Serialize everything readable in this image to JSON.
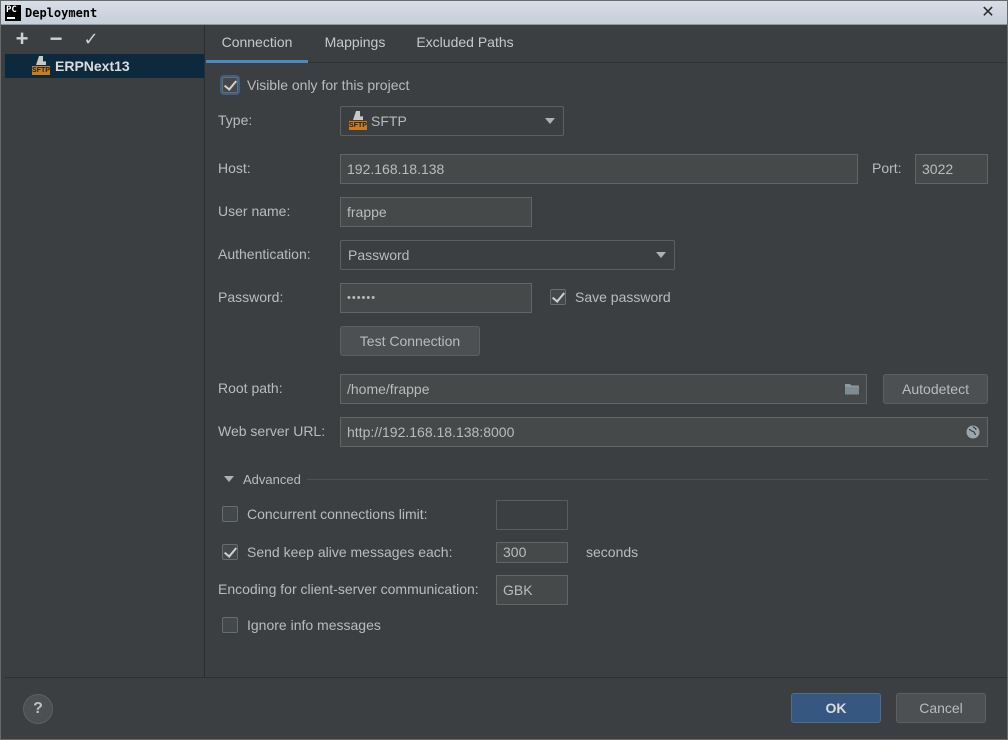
{
  "window": {
    "title": "Deployment",
    "app_icon": "PC",
    "close": "✕"
  },
  "toolbar": {
    "add": "+",
    "remove": "−",
    "apply": "✓"
  },
  "servers": [
    {
      "name": "ERPNext13",
      "icon": "sftp-icon",
      "icon_text": "SFTP"
    }
  ],
  "tabs": [
    {
      "label": "Connection",
      "active": true
    },
    {
      "label": "Mappings"
    },
    {
      "label": "Excluded Paths"
    }
  ],
  "form": {
    "visible_only": {
      "label": "Visible only for this project",
      "checked": true
    },
    "type": {
      "label": "Type:",
      "value": "SFTP",
      "icon_text": "SFTP"
    },
    "host": {
      "label": "Host:",
      "value": "192.168.18.138"
    },
    "port": {
      "label": "Port:",
      "value": "3022"
    },
    "username": {
      "label": "User name:",
      "value": "frappe"
    },
    "authentication": {
      "label": "Authentication:",
      "value": "Password"
    },
    "password": {
      "label": "Password:",
      "value": "••••••"
    },
    "save_password": {
      "label": "Save password",
      "checked": true
    },
    "test_connection": {
      "label": "Test Connection"
    },
    "root_path": {
      "label": "Root path:",
      "value": "/home/frappe"
    },
    "autodetect": {
      "label": "Autodetect"
    },
    "web_server_url": {
      "label": "Web server URL:",
      "value": "http://192.168.18.138:8000"
    }
  },
  "advanced": {
    "header": "Advanced",
    "concurrent": {
      "label": "Concurrent connections limit:",
      "checked": false,
      "value": ""
    },
    "keep_alive": {
      "label": "Send keep alive messages each:",
      "checked": true,
      "value": "300",
      "unit": "seconds"
    },
    "encoding": {
      "label": "Encoding for client-server communication:",
      "value": "GBK"
    },
    "ignore_info": {
      "label": "Ignore info messages",
      "checked": false
    }
  },
  "footer": {
    "help": "?",
    "ok": "OK",
    "cancel": "Cancel"
  }
}
